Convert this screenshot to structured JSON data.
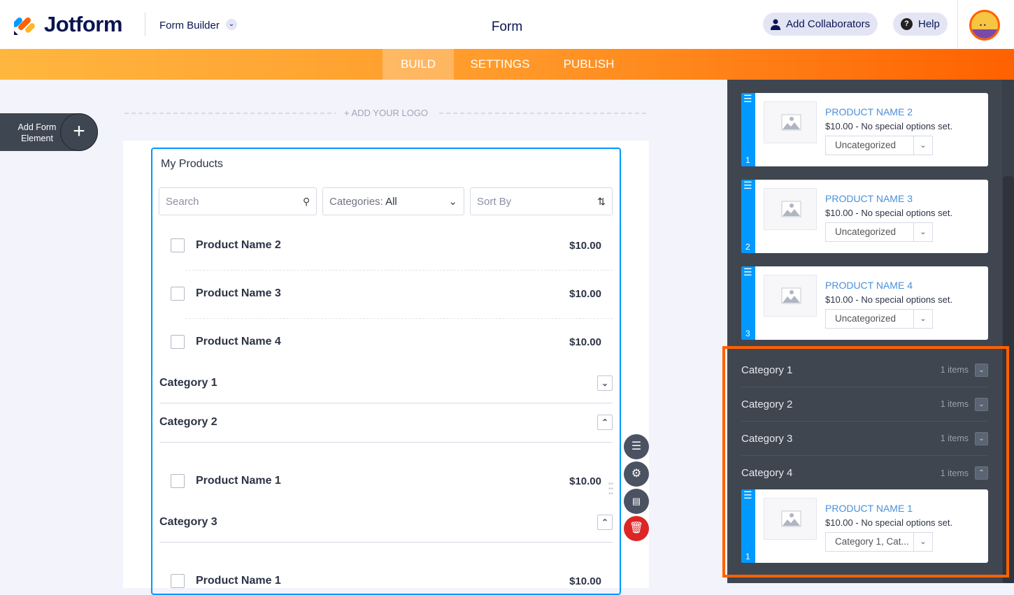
{
  "header": {
    "brand": "Jotform",
    "builder_label": "Form Builder",
    "title": "Form",
    "add_collaborators": "Add Collaborators",
    "help": "Help"
  },
  "nav": {
    "tabs": [
      "BUILD",
      "SETTINGS",
      "PUBLISH"
    ],
    "active": "BUILD"
  },
  "canvas": {
    "add_element": "Add Form Element",
    "add_logo": "+ ADD YOUR LOGO"
  },
  "widget": {
    "title": "My Products",
    "search_placeholder": "Search",
    "categories_label": "Categories:",
    "categories_value": "All",
    "sort_label": "Sort By",
    "products": [
      {
        "name": "Product Name 2",
        "price": "$10.00"
      },
      {
        "name": "Product Name 3",
        "price": "$10.00"
      },
      {
        "name": "Product Name 4",
        "price": "$10.00"
      }
    ],
    "categories": [
      {
        "name": "Category 1",
        "expanded": false,
        "products": []
      },
      {
        "name": "Category 2",
        "expanded": true,
        "products": [
          {
            "name": "Product Name 1",
            "price": "$10.00"
          }
        ]
      },
      {
        "name": "Category 3",
        "expanded": true,
        "products": [
          {
            "name": "Product Name 1",
            "price": "$10.00"
          }
        ]
      }
    ]
  },
  "panel": {
    "products": [
      {
        "index": "1",
        "name": "PRODUCT NAME 2",
        "desc": "$10.00 - No special options set.",
        "category": "Uncategorized"
      },
      {
        "index": "2",
        "name": "PRODUCT NAME 3",
        "desc": "$10.00 - No special options set.",
        "category": "Uncategorized"
      },
      {
        "index": "3",
        "name": "PRODUCT NAME 4",
        "desc": "$10.00 - No special options set.",
        "category": "Uncategorized"
      }
    ],
    "categories": [
      {
        "name": "Category 1",
        "count": "1 items"
      },
      {
        "name": "Category 2",
        "count": "1 items"
      },
      {
        "name": "Category 3",
        "count": "1 items"
      },
      {
        "name": "Category 4",
        "count": "1 items"
      }
    ],
    "category4_product": {
      "index": "1",
      "name": "PRODUCT NAME 1",
      "desc": "$10.00 - No special options set.",
      "category": "Category 1, Cat..."
    }
  },
  "colors": {
    "accent": "#ff6100",
    "blue": "#0099ff",
    "panel": "#3f4650"
  }
}
